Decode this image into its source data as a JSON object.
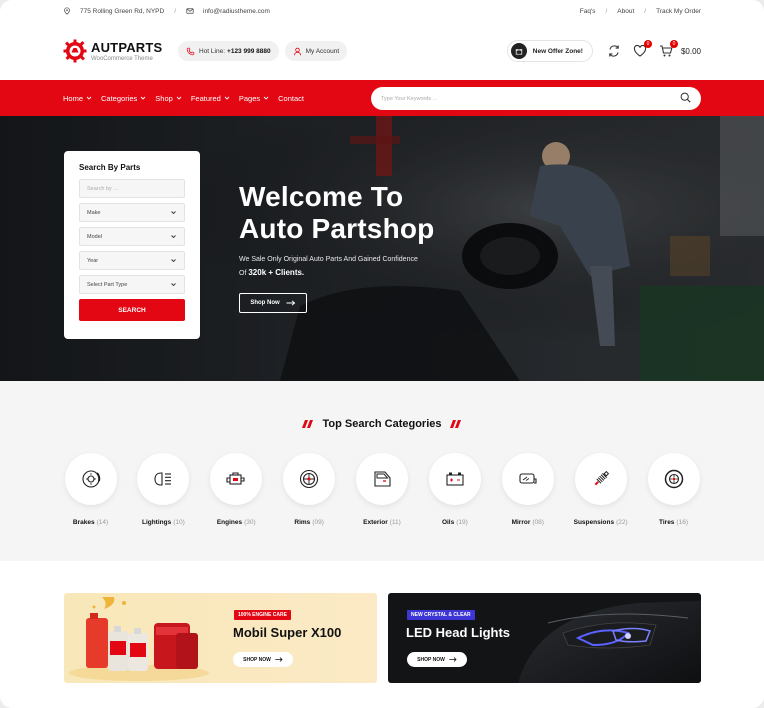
{
  "topbar": {
    "address": "775 Rolling Green Rd, NYPD",
    "email": "info@radiustheme.com",
    "links": [
      "Faq's",
      "About",
      "Track My Order"
    ]
  },
  "header": {
    "logo_name": "AUTPARTS",
    "logo_tagline": "WooCommerce Theme",
    "hotline_label": "Hot Line:",
    "hotline_number": "+123 999 8880",
    "account_label": "My Account",
    "offer_label": "New Offer Zone!",
    "wishlist_count": "0",
    "cart_count": "0",
    "cart_total": "$0.00"
  },
  "nav": {
    "items": [
      "Home",
      "Categories",
      "Shop",
      "Featured",
      "Pages",
      "Contact"
    ],
    "search_placeholder": "Type Your Keywords ..."
  },
  "hero": {
    "title": "Welcome To\nAuto Partshop",
    "subtitle_prefix": "We Sale Only Original Auto Parts And Gained Confidence Of",
    "subtitle_highlight": "320k + Clients.",
    "button_label": "Shop Now"
  },
  "search_parts": {
    "title": "Search By Parts",
    "search_placeholder": "Search by ...",
    "selects": [
      "Make",
      "Model",
      "Year",
      "Select Part Type"
    ],
    "button_label": "SEARCH"
  },
  "categories": {
    "title": "Top Search Categories",
    "items": [
      {
        "name": "Brakes",
        "count": "(14)",
        "icon": "brake-disc-icon"
      },
      {
        "name": "Lightings",
        "count": "(10)",
        "icon": "headlight-icon"
      },
      {
        "name": "Engines",
        "count": "(30)",
        "icon": "engine-icon"
      },
      {
        "name": "Rims",
        "count": "(09)",
        "icon": "rim-icon"
      },
      {
        "name": "Exterior",
        "count": "(11)",
        "icon": "car-door-icon"
      },
      {
        "name": "Oils",
        "count": "(19)",
        "icon": "battery-icon"
      },
      {
        "name": "Mirror",
        "count": "(08)",
        "icon": "mirror-icon"
      },
      {
        "name": "Suspensions",
        "count": "(22)",
        "icon": "suspension-icon"
      },
      {
        "name": "Tires",
        "count": "(16)",
        "icon": "tire-icon"
      }
    ]
  },
  "banners": [
    {
      "tag": "100% ENGINE CARE",
      "title": "Mobil Super X100",
      "button": "SHOP NOW",
      "tag_color": "#e30613"
    },
    {
      "tag": "NEW CRYSTAL & CLEAR",
      "title": "LED Head Lights",
      "button": "SHOP NOW",
      "tag_color": "#3d35d6"
    }
  ],
  "colors": {
    "accent": "#e30613",
    "dark": "#111111"
  }
}
